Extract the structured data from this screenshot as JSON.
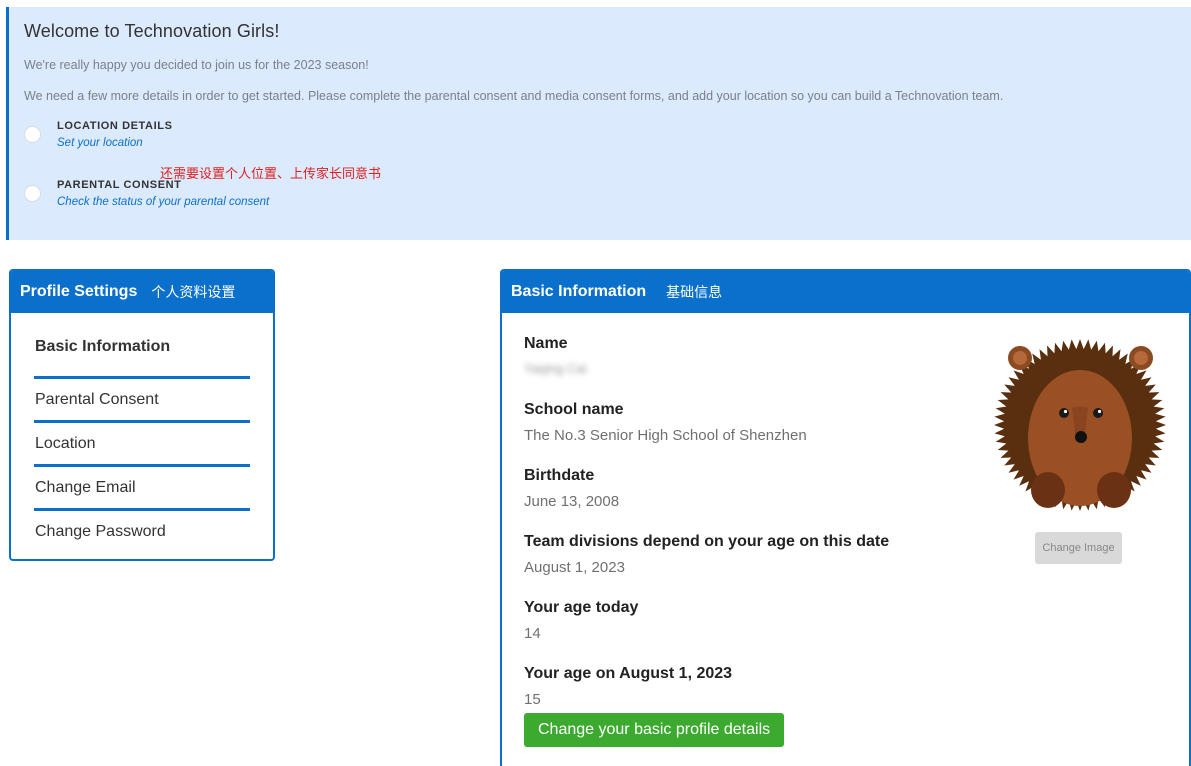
{
  "welcome": {
    "title": "Welcome to Technovation Girls!",
    "line1": "We're really happy you decided to join us for the 2023 season!",
    "line2": "We need a few more details in order to get started. Please complete the parental consent and media consent forms, and add your location so you can build a Technovation team.",
    "steps": [
      {
        "title": "LOCATION DETAILS",
        "link": "Set your location"
      },
      {
        "title": "PARENTAL CONSENT",
        "link": "Check the status of your parental consent"
      }
    ],
    "annotation": "还需要设置个人位置、上传家长同意书"
  },
  "settings": {
    "title": "Profile Settings",
    "title_cn": "个人资料设置",
    "items": [
      {
        "label": "Basic Information"
      },
      {
        "label": "Parental Consent"
      },
      {
        "label": "Location"
      },
      {
        "label": "Change Email"
      },
      {
        "label": "Change Password"
      }
    ]
  },
  "basic": {
    "title": "Basic Information",
    "title_cn": "基础信息",
    "fields": [
      {
        "label": "Name",
        "value": "Yaqing Cai"
      },
      {
        "label": "School name",
        "value": "The No.3 Senior High School of Shenzhen"
      },
      {
        "label": "Birthdate",
        "value": "June 13, 2008"
      },
      {
        "label": "Team divisions depend on your age on this date",
        "value": "August 1, 2023"
      },
      {
        "label": "Your age today",
        "value": "14"
      },
      {
        "label": "Your age on August 1, 2023",
        "value": "15"
      }
    ],
    "change_image": "Change Image",
    "change_details": "Change your basic profile details"
  },
  "colors": {
    "primary": "#0a70cc",
    "banner_bg": "#dbeafd",
    "success": "#3caa2f",
    "annotation": "#e02020"
  }
}
